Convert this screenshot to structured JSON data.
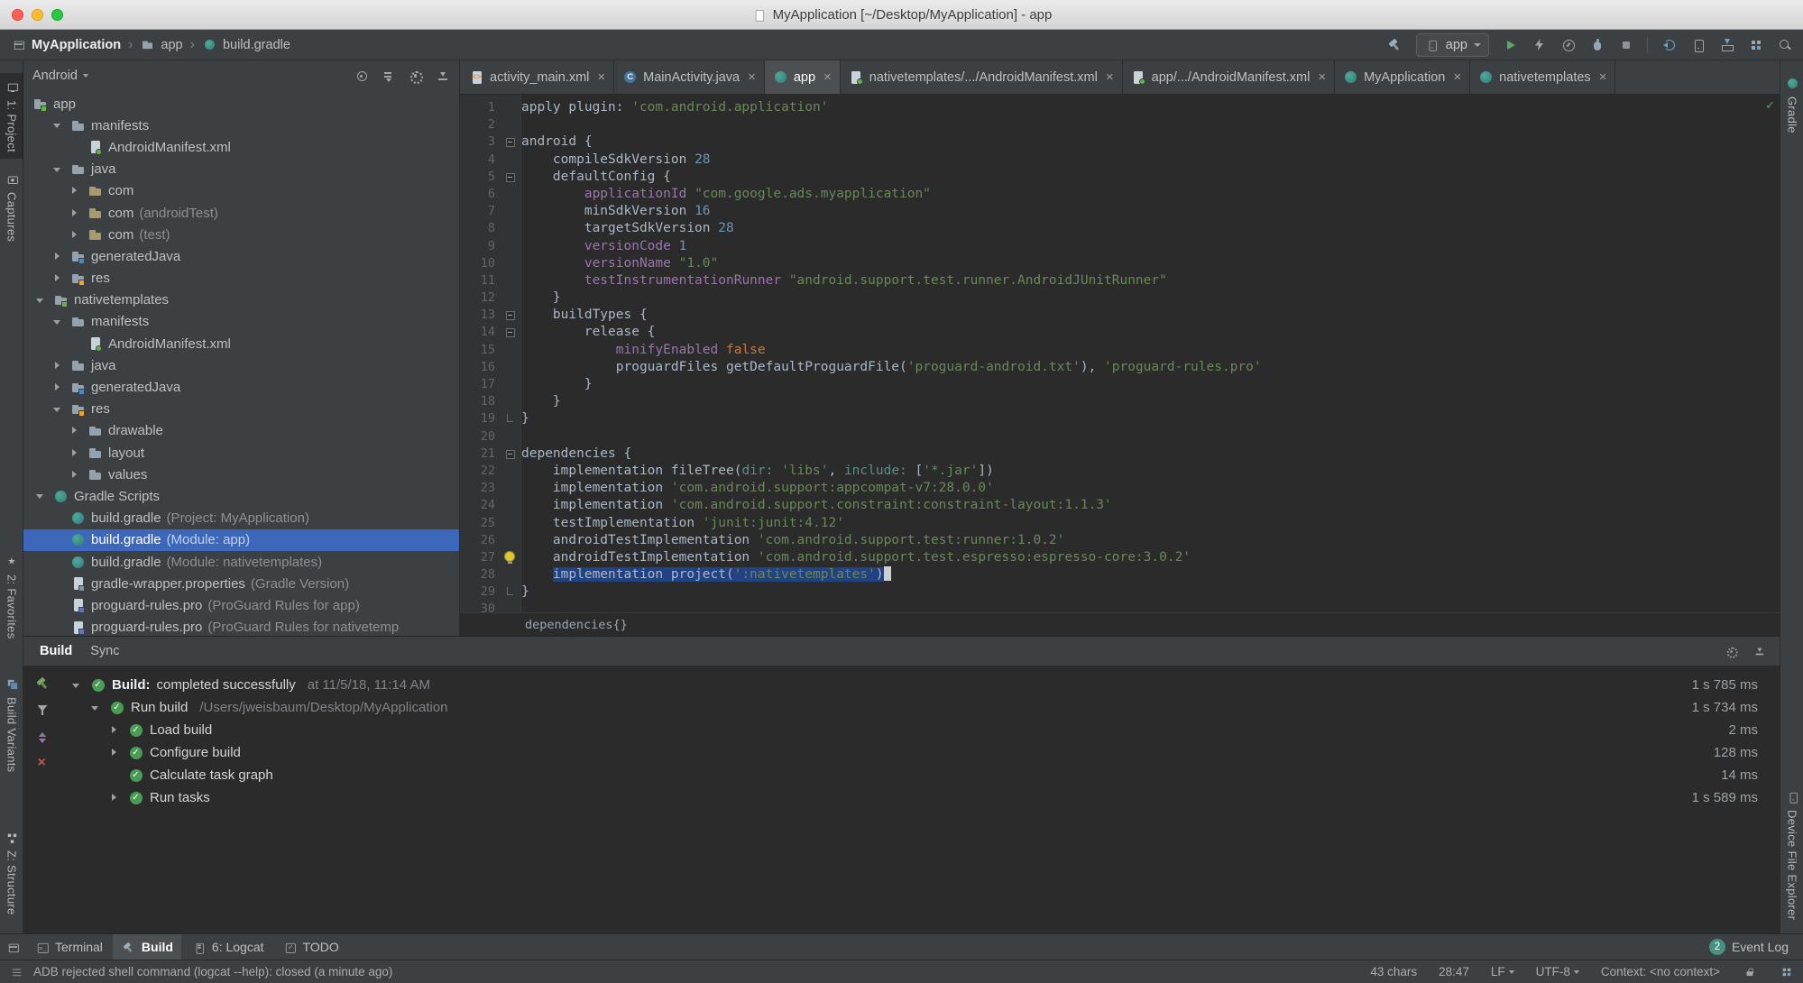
{
  "window": {
    "title": "MyApplication [~/Desktop/MyApplication] - app"
  },
  "toolbar": {
    "breadcrumbs": [
      "MyApplication",
      "app",
      "build.gradle"
    ],
    "run_config": "app",
    "icons_right": [
      "run",
      "apply-changes",
      "profile",
      "attach-debugger",
      "stop",
      "separator",
      "sync-project",
      "avd-manager",
      "sdk-manager",
      "layout-inspector",
      "search-everywhere"
    ]
  },
  "left_stripe": {
    "items": [
      {
        "label": "1: Project",
        "icon": "monitor",
        "active": true
      },
      {
        "label": "Captures",
        "icon": "camera"
      },
      {
        "label": "2: Favorites",
        "icon": "star"
      },
      {
        "label": "Build Variants",
        "icon": "layers"
      },
      {
        "label": "Z: Structure",
        "icon": "structure"
      }
    ]
  },
  "right_stripe": {
    "items": [
      {
        "label": "Gradle",
        "icon": "gradle"
      },
      {
        "label": "Device File Explorer",
        "icon": "phone"
      }
    ]
  },
  "project_panel": {
    "selector": "Android",
    "header_icons": [
      "locate",
      "collapse-all",
      "settings",
      "hide"
    ],
    "tree": [
      {
        "ind": 0,
        "chev": "",
        "nochev": true,
        "icon": "module",
        "label": "app"
      },
      {
        "ind": 1,
        "chev": "d",
        "icon": "folder",
        "label": "manifests"
      },
      {
        "ind": 2,
        "chev": "",
        "icon": "manifest",
        "label": "AndroidManifest.xml"
      },
      {
        "ind": 1,
        "chev": "d",
        "icon": "folder",
        "label": "java"
      },
      {
        "ind": 2,
        "chev": "r",
        "icon": "package",
        "label": "com"
      },
      {
        "ind": 2,
        "chev": "r",
        "icon": "package",
        "label": "com",
        "suffix": "(androidTest)"
      },
      {
        "ind": 2,
        "chev": "r",
        "icon": "package",
        "label": "com",
        "suffix": "(test)"
      },
      {
        "ind": 1,
        "chev": "r",
        "icon": "generated",
        "label": "generatedJava"
      },
      {
        "ind": 1,
        "chev": "r",
        "icon": "res",
        "label": "res"
      },
      {
        "ind": 0,
        "chev": "d",
        "icon": "module",
        "label": "nativetemplates"
      },
      {
        "ind": 1,
        "chev": "d",
        "icon": "folder",
        "label": "manifests"
      },
      {
        "ind": 2,
        "chev": "",
        "icon": "manifest",
        "label": "AndroidManifest.xml"
      },
      {
        "ind": 1,
        "chev": "r",
        "icon": "folder",
        "label": "java"
      },
      {
        "ind": 1,
        "chev": "r",
        "icon": "generated",
        "label": "generatedJava"
      },
      {
        "ind": 1,
        "chev": "d",
        "icon": "res",
        "label": "res"
      },
      {
        "ind": 2,
        "chev": "r",
        "icon": "folder",
        "label": "drawable"
      },
      {
        "ind": 2,
        "chev": "r",
        "icon": "folder",
        "label": "layout"
      },
      {
        "ind": 2,
        "chev": "r",
        "icon": "folder",
        "label": "values"
      },
      {
        "ind": 0,
        "chev": "d",
        "icon": "gradle",
        "label": "Gradle Scripts"
      },
      {
        "ind": 1,
        "chev": "",
        "icon": "gradle",
        "label": "build.gradle",
        "suffix": "(Project: MyApplication)"
      },
      {
        "ind": 1,
        "chev": "",
        "icon": "gradle",
        "label": "build.gradle",
        "suffix": "(Module: app)",
        "sel": true
      },
      {
        "ind": 1,
        "chev": "",
        "icon": "gradle",
        "label": "build.gradle",
        "suffix": "(Module: nativetemplates)"
      },
      {
        "ind": 1,
        "chev": "",
        "icon": "properties",
        "label": "gradle-wrapper.properties",
        "suffix": "(Gradle Version)"
      },
      {
        "ind": 1,
        "chev": "",
        "icon": "proguard",
        "label": "proguard-rules.pro",
        "suffix": "(ProGuard Rules for app)"
      },
      {
        "ind": 1,
        "chev": "",
        "icon": "proguard",
        "label": "proguard-rules.pro",
        "suffix": "(ProGuard Rules for nativetemp"
      }
    ]
  },
  "editor": {
    "tabs": [
      {
        "label": "activity_main.xml",
        "icon": "xml"
      },
      {
        "label": "MainActivity.java",
        "icon": "class"
      },
      {
        "label": "app",
        "icon": "gradle",
        "active": true
      },
      {
        "label": "nativetemplates/.../AndroidManifest.xml",
        "icon": "manifest"
      },
      {
        "label": "app/.../AndroidManifest.xml",
        "icon": "manifest"
      },
      {
        "label": "MyApplication",
        "icon": "gradle"
      },
      {
        "label": "nativetemplates",
        "icon": "gradle"
      }
    ],
    "breadcrumb": "dependencies{}",
    "lines": [
      {
        "s": [
          [
            "apply plugin: ",
            "d"
          ],
          [
            "'com.android.application'",
            "s"
          ]
        ]
      },
      {
        "s": []
      },
      {
        "s": [
          [
            "android {",
            "d"
          ]
        ],
        "fold": "m"
      },
      {
        "s": [
          [
            "    compileSdkVersion ",
            "d"
          ],
          [
            "28",
            "n"
          ]
        ]
      },
      {
        "s": [
          [
            "    defaultConfig {",
            "d"
          ]
        ],
        "fold": "m"
      },
      {
        "s": [
          [
            "        ",
            "d"
          ],
          [
            "applicationId ",
            "p"
          ],
          [
            "\"com.google.ads.myapplication\"",
            "s"
          ]
        ]
      },
      {
        "s": [
          [
            "        minSdkVersion ",
            "d"
          ],
          [
            "16",
            "n"
          ]
        ]
      },
      {
        "s": [
          [
            "        targetSdkVersion ",
            "d"
          ],
          [
            "28",
            "n"
          ]
        ]
      },
      {
        "s": [
          [
            "        ",
            "d"
          ],
          [
            "versionCode ",
            "p"
          ],
          [
            "1",
            "n"
          ]
        ]
      },
      {
        "s": [
          [
            "        ",
            "d"
          ],
          [
            "versionName ",
            "p"
          ],
          [
            "\"1.0\"",
            "s"
          ]
        ]
      },
      {
        "s": [
          [
            "        ",
            "d"
          ],
          [
            "testInstrumentationRunner ",
            "p"
          ],
          [
            "\"android.support.test.runner.AndroidJUnitRunner\"",
            "s"
          ]
        ]
      },
      {
        "s": [
          [
            "    }",
            "d"
          ]
        ]
      },
      {
        "s": [
          [
            "    buildTypes {",
            "d"
          ]
        ],
        "fold": "m"
      },
      {
        "s": [
          [
            "        release {",
            "d"
          ]
        ],
        "fold": "m"
      },
      {
        "s": [
          [
            "            ",
            "d"
          ],
          [
            "minifyEnabled ",
            "p"
          ],
          [
            "false",
            "k"
          ]
        ]
      },
      {
        "s": [
          [
            "            proguardFiles getDefaultProguardFile(",
            "d"
          ],
          [
            "'proguard-android.txt'",
            "s"
          ],
          [
            "), ",
            "d"
          ],
          [
            "'proguard-rules.pro'",
            "s"
          ]
        ]
      },
      {
        "s": [
          [
            "        }",
            "d"
          ]
        ]
      },
      {
        "s": [
          [
            "    }",
            "d"
          ]
        ]
      },
      {
        "s": [
          [
            "}",
            "d"
          ]
        ],
        "fold": "e"
      },
      {
        "s": []
      },
      {
        "s": [
          [
            "dependencies {",
            "d"
          ]
        ],
        "fold": "m"
      },
      {
        "s": [
          [
            "    implementation fileTree(",
            "d"
          ],
          [
            "dir: ",
            "a"
          ],
          [
            "'libs'",
            "s"
          ],
          [
            ", ",
            "d"
          ],
          [
            "include: ",
            "a"
          ],
          [
            "[",
            "d"
          ],
          [
            "'*.jar'",
            "s"
          ],
          [
            "])",
            "d"
          ]
        ]
      },
      {
        "s": [
          [
            "    implementation ",
            "d"
          ],
          [
            "'com.android.support:appcompat-v7:28.0.0'",
            "s"
          ]
        ]
      },
      {
        "s": [
          [
            "    implementation ",
            "d"
          ],
          [
            "'com.android.support.constraint:constraint-layout:1.1.3'",
            "s"
          ]
        ]
      },
      {
        "s": [
          [
            "    testImplementation ",
            "d"
          ],
          [
            "'junit:junit:4.12'",
            "s"
          ]
        ]
      },
      {
        "s": [
          [
            "    androidTestImplementation ",
            "d"
          ],
          [
            "'com.android.support.test:runner:1.0.2'",
            "s"
          ]
        ]
      },
      {
        "s": [
          [
            "    androidTestImplementation ",
            "d"
          ],
          [
            "'com.android.support.test.espresso:espresso-core:3.0.2'",
            "s"
          ]
        ],
        "bulb": true
      },
      {
        "s": [
          [
            "    ",
            "d"
          ],
          [
            "implementation project(",
            "d",
            1
          ],
          [
            "':nativetemplates'",
            "s",
            1
          ],
          [
            ")",
            "d",
            1
          ]
        ],
        "caret": true
      },
      {
        "s": [
          [
            "}",
            "d"
          ]
        ],
        "fold": "e"
      },
      {
        "s": []
      }
    ]
  },
  "build_panel": {
    "tabs": [
      "Build",
      "Sync"
    ],
    "tool_icons": [
      "rerun-build",
      "filter",
      "expand-collapse",
      "close"
    ],
    "rows": [
      {
        "ind": 0,
        "chev": "d",
        "bold": "Build:",
        "label": "completed successfully",
        "gray": "at 11/5/18, 11:14 AM",
        "time": "1 s 785 ms"
      },
      {
        "ind": 1,
        "chev": "d",
        "label": "Run build",
        "gray": "/Users/jweisbaum/Desktop/MyApplication",
        "time": "1 s 734 ms"
      },
      {
        "ind": 2,
        "chev": "r",
        "label": "Load build",
        "time": "2 ms"
      },
      {
        "ind": 2,
        "chev": "r",
        "label": "Configure build",
        "time": "128 ms"
      },
      {
        "ind": 2,
        "chev": "",
        "label": "Calculate task graph",
        "time": "14 ms"
      },
      {
        "ind": 2,
        "chev": "r",
        "label": "Run tasks",
        "time": "1 s 589 ms"
      }
    ]
  },
  "bottom_bar": {
    "items": [
      {
        "label": "Terminal"
      },
      {
        "label": "Build",
        "active": true
      },
      {
        "label": "6: Logcat"
      },
      {
        "label": "TODO"
      }
    ],
    "event_log": {
      "label": "Event Log",
      "badge": "2"
    }
  },
  "status_bar": {
    "message": "ADB rejected shell command (logcat --help): closed (a minute ago)",
    "selection_info": "43 chars",
    "caret_position": "28:47",
    "line_ending": "LF",
    "encoding": "UTF-8",
    "context": "Context: <no context>"
  }
}
